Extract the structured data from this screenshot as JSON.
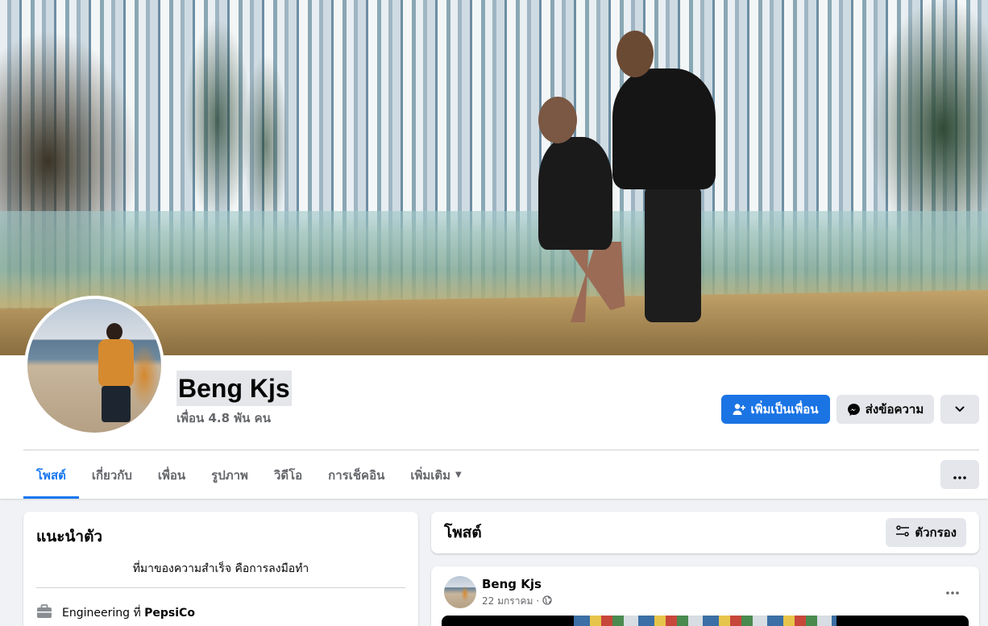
{
  "profile": {
    "name": "Beng Kjs",
    "friends_count": "เพื่อน 4.8 พัน คน"
  },
  "actions": {
    "add_friend": "เพิ่มเป็นเพื่อน",
    "message": "ส่งข้อความ"
  },
  "tabs": [
    {
      "label": "โพสต์",
      "active": true
    },
    {
      "label": "เกี่ยวกับ"
    },
    {
      "label": "เพื่อน"
    },
    {
      "label": "รูปภาพ"
    },
    {
      "label": "วิดีโอ"
    },
    {
      "label": "การเช็คอิน"
    },
    {
      "label": "เพิ่มเติม"
    }
  ],
  "intro": {
    "title": "แนะนำตัว",
    "bio": "ที่มาของความสำเร็จ คือการลงมือทำ",
    "work_prefix": "Engineering ที่",
    "work_company": "PepsiCo"
  },
  "posts_section": {
    "title": "โพสต์",
    "filter_label": "ตัวกรอง"
  },
  "post": {
    "author": "Beng Kjs",
    "date": "22 มกราคม ·"
  },
  "colors": {
    "primary": "#1b74e4",
    "tab_active": "#1877f2",
    "secondary_bg": "#e4e6eb",
    "page_bg": "#f0f2f5",
    "muted_text": "#65676b"
  },
  "icons": {
    "add_friend": "add-friend-icon",
    "message": "messenger-icon",
    "more": "chevron-down-icon",
    "tab_menu": "more-horizontal-icon",
    "filter": "filter-icon",
    "work": "briefcase-icon",
    "privacy": "globe-icon"
  }
}
